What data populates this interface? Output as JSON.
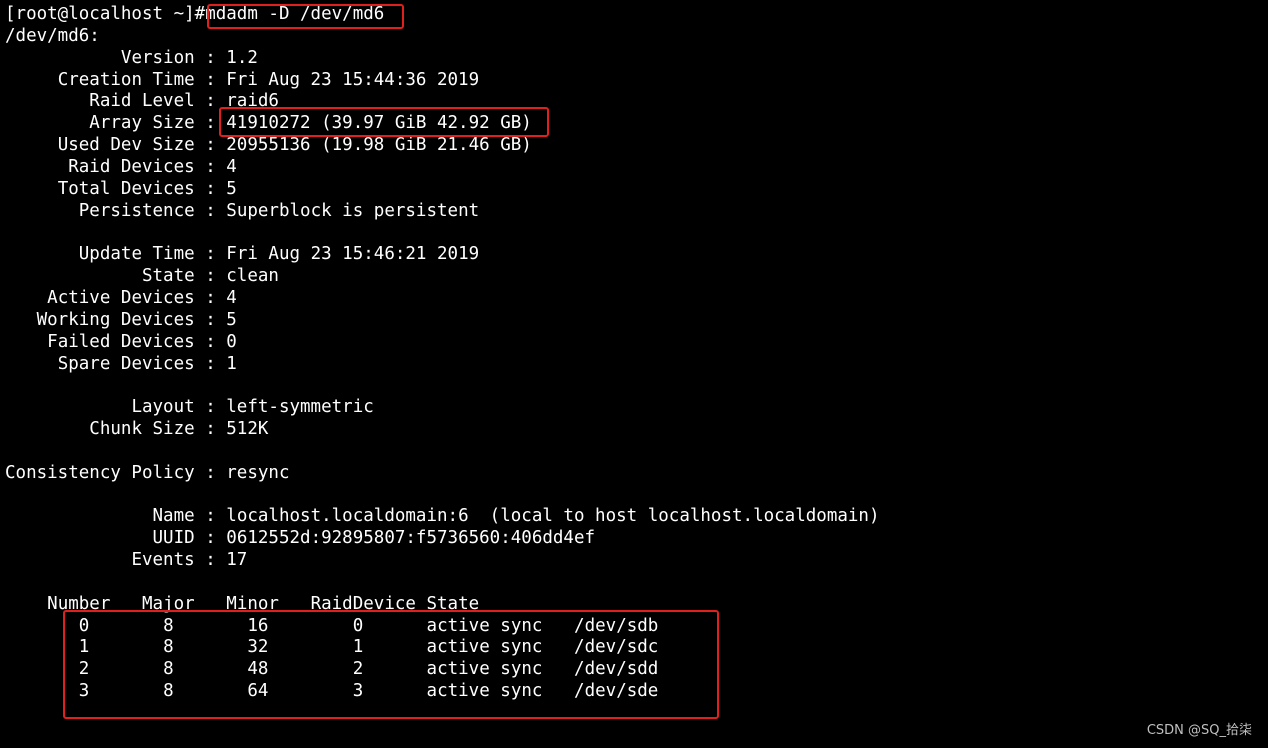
{
  "terminal": {
    "prompt": "[root@localhost ~]#",
    "command": "mdadm -D /dev/md6",
    "device_header": "/dev/md6:",
    "fields": [
      {
        "key": "Version",
        "value": "1.2"
      },
      {
        "key": "Creation Time",
        "value": "Fri Aug 23 15:44:36 2019"
      },
      {
        "key": "Raid Level",
        "value": "raid6"
      },
      {
        "key": "Array Size",
        "value": "41910272 (39.97 GiB 42.92 GB)"
      },
      {
        "key": "Used Dev Size",
        "value": "20955136 (19.98 GiB 21.46 GB)"
      },
      {
        "key": "Raid Devices",
        "value": "4"
      },
      {
        "key": "Total Devices",
        "value": "5"
      },
      {
        "key": "Persistence",
        "value": "Superblock is persistent"
      },
      null,
      {
        "key": "Update Time",
        "value": "Fri Aug 23 15:46:21 2019"
      },
      {
        "key": "State",
        "value": "clean"
      },
      {
        "key": "Active Devices",
        "value": "4"
      },
      {
        "key": "Working Devices",
        "value": "5"
      },
      {
        "key": "Failed Devices",
        "value": "0"
      },
      {
        "key": "Spare Devices",
        "value": "1"
      },
      null,
      {
        "key": "Layout",
        "value": "left-symmetric"
      },
      {
        "key": "Chunk Size",
        "value": "512K"
      },
      null,
      {
        "key": "Consistency Policy",
        "value": "resync"
      },
      null,
      {
        "key": "Name",
        "value": "localhost.localdomain:6  (local to host localhost.localdomain)"
      },
      {
        "key": "UUID",
        "value": "0612552d:92895807:f5736560:406dd4ef"
      },
      {
        "key": "Events",
        "value": "17"
      },
      null
    ],
    "device_table": {
      "headers": [
        "Number",
        "Major",
        "Minor",
        "RaidDevice",
        "State"
      ],
      "rows": [
        {
          "number": "0",
          "major": "8",
          "minor": "16",
          "raid_device": "0",
          "state": "active sync",
          "device": "/dev/sdb"
        },
        {
          "number": "1",
          "major": "8",
          "minor": "32",
          "raid_device": "1",
          "state": "active sync",
          "device": "/dev/sdc"
        },
        {
          "number": "2",
          "major": "8",
          "minor": "48",
          "raid_device": "2",
          "state": "active sync",
          "device": "/dev/sdd"
        },
        {
          "number": "3",
          "major": "8",
          "minor": "64",
          "raid_device": "3",
          "state": "active sync",
          "device": "/dev/sde"
        }
      ]
    }
  },
  "highlight_color": "#e0201c",
  "watermark": "CSDN @SQ_拾柒"
}
